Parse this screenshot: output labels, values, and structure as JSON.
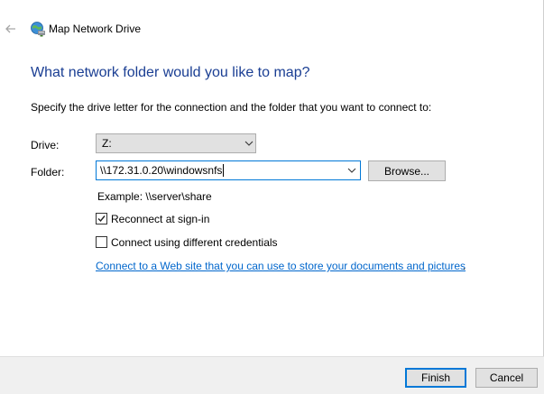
{
  "window": {
    "title": "Map Network Drive",
    "back_icon": "back-arrow-icon",
    "app_icon": "network-drive-icon"
  },
  "main": {
    "heading": "What network folder would you like to map?",
    "instruction": "Specify the drive letter for the connection and the folder that you want to connect to:"
  },
  "form": {
    "drive": {
      "label": "Drive:",
      "value": "Z:"
    },
    "folder": {
      "label": "Folder:",
      "value": "\\\\172.31.0.20\\windowsnfs"
    },
    "browse_label": "Browse...",
    "example": "Example: \\\\server\\share",
    "reconnect": {
      "label": "Reconnect at sign-in",
      "checked": true
    },
    "credentials": {
      "label": "Connect using different credentials",
      "checked": false
    },
    "link_text": "Connect to a Web site that you can use to store your documents and pictures",
    "link_suffix": "."
  },
  "footer": {
    "finish_label": "Finish",
    "cancel_label": "Cancel"
  },
  "colors": {
    "heading": "#1a3e93",
    "link": "#0066cc",
    "accent": "#0078d7",
    "footer_bg": "#f0f0f0",
    "button_bg": "#e1e1e1"
  }
}
